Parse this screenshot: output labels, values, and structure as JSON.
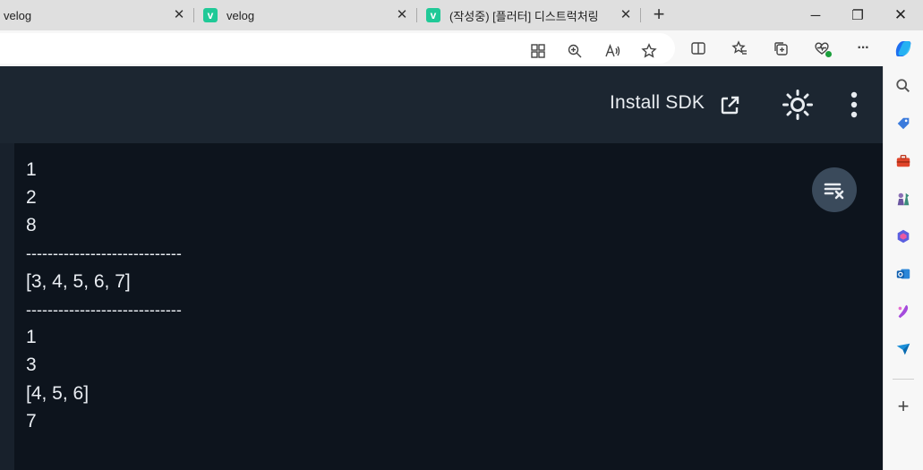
{
  "browser": {
    "tabs": [
      {
        "title": "velog",
        "close": "✕",
        "favicon": ""
      },
      {
        "title": "velog",
        "close": "✕",
        "favicon": "v"
      },
      {
        "title": "(작성중) [플러터] 디스트럭처링",
        "close": "✕",
        "favicon": "v"
      }
    ],
    "new_tab_label": "+",
    "window_controls": {
      "minimize": "─",
      "restore": "❐",
      "close": "✕"
    },
    "toolbar_icons": [
      "apps-icon",
      "zoom-icon",
      "read-aloud-icon",
      "favorite-star-icon",
      "split-screen-icon",
      "favorites-icon",
      "collections-icon",
      "browser-essentials-icon",
      "more-icon",
      "copilot-icon"
    ],
    "more_label": "···"
  },
  "sidebar": {
    "icons": [
      "search-icon",
      "shopping-tag-icon",
      "tools-icon",
      "games-icon",
      "microsoft365-icon",
      "outlook-icon",
      "designer-icon",
      "send-icon",
      "add-icon"
    ],
    "add_label": "+"
  },
  "header": {
    "install_sdk_label": "Install SDK"
  },
  "console": {
    "lines": [
      "1",
      "2",
      "8",
      "-----------------------------",
      "[3, 4, 5, 6, 7]",
      "-----------------------------",
      "1",
      "3",
      "[4, 5, 6]",
      "7"
    ]
  },
  "colors": {
    "header_bg": "#1c2631",
    "console_bg": "#0d141d",
    "console_text": "#e9edf2",
    "velog_green": "#20c997",
    "clear_button_bg": "#3a4a5b"
  }
}
